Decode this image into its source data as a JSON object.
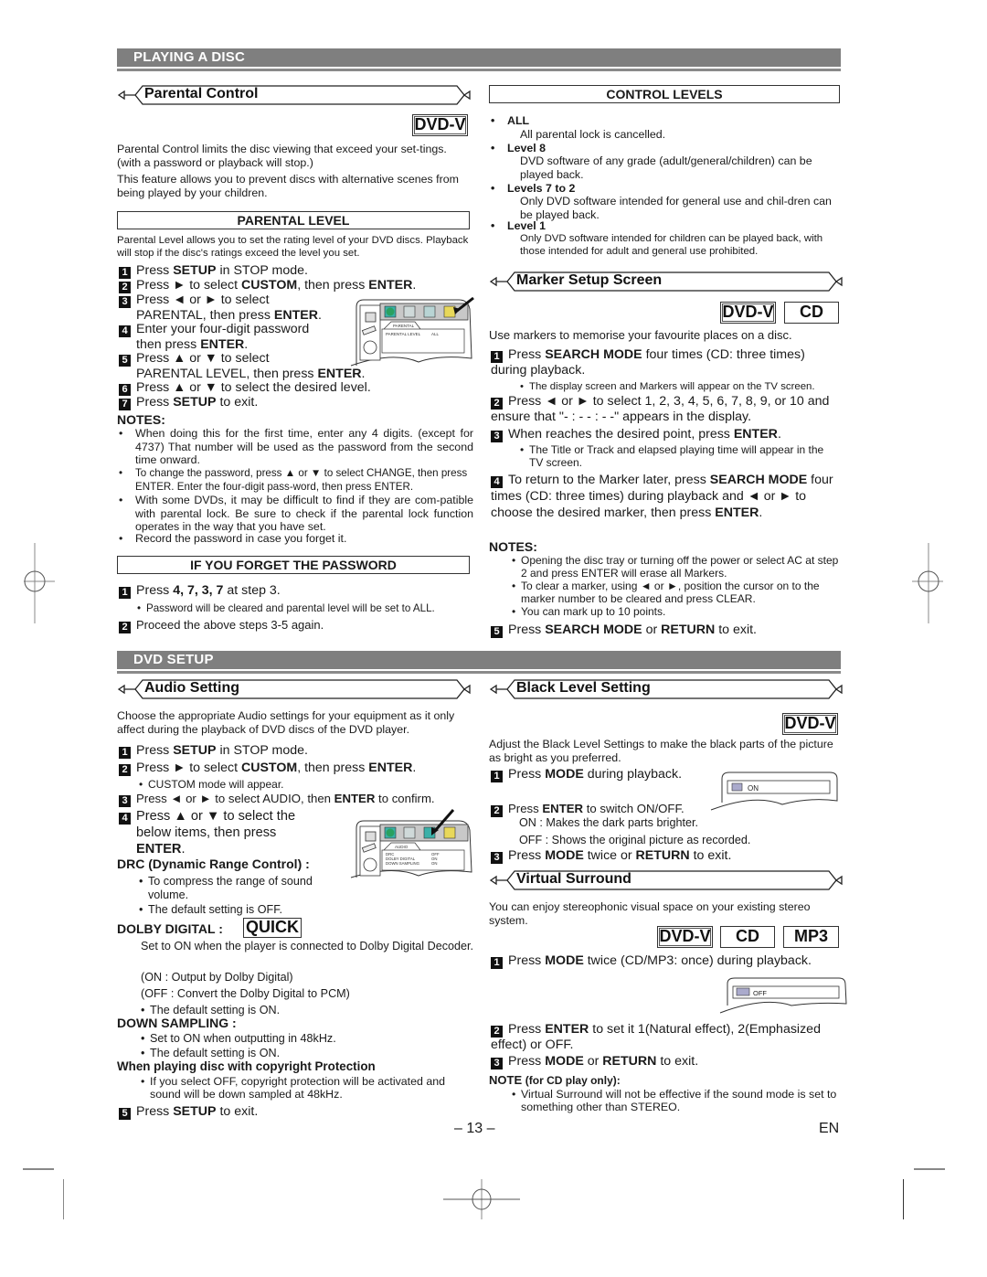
{
  "sections": {
    "playing_a_disc": "PLAYING A DISC",
    "dvd_setup": "DVD SETUP"
  },
  "badges": {
    "dvd_v": "DVD-V",
    "cd": "CD",
    "mp3": "MP3",
    "quick": "QUICK"
  },
  "parental_control": {
    "title": "Parental Control",
    "intro1": "Parental Control limits the disc viewing that exceed your set-tings. (with a password or playback will stop.)",
    "intro2": "This feature allows you to prevent discs with alternative scenes from being played by your children.",
    "parental_level_heading": "PARENTAL LEVEL",
    "parental_level_text": "Parental Level allows you to set the rating level of your DVD discs. Playback will stop if the disc's ratings exceed the level you set.",
    "steps": [
      {
        "n": "1",
        "pre": "Press ",
        "bold": "SETUP",
        "post": " in STOP mode."
      },
      {
        "n": "2",
        "pre": "Press ► to select ",
        "bold": "CUSTOM",
        "mid": ", then press ",
        "bold2": "ENTER",
        "post": "."
      },
      {
        "n": "3",
        "pre": "Press ◄ or ► to select",
        "line2": "PARENTAL, then press ",
        "bold": "ENTER",
        "post": "."
      },
      {
        "n": "4",
        "pre": "Enter your four-digit password",
        "line2": "then press ",
        "bold": "ENTER",
        "post": "."
      },
      {
        "n": "5",
        "pre": "Press ▲ or ▼ to select",
        "line2": "PARENTAL LEVEL, then press ",
        "bold": "ENTER",
        "post": "."
      },
      {
        "n": "6",
        "pre": "Press ▲ or ▼ to select the desired level."
      },
      {
        "n": "7",
        "pre": "Press ",
        "bold": "SETUP",
        "post": " to exit."
      }
    ],
    "osd": {
      "tab": "PARENTAL",
      "row_label": "PARENTAL LEVEL",
      "row_value": "ALL"
    },
    "notes_heading": "NOTES:",
    "notes": [
      "When doing this for the first time, enter any 4 digits. (except for 4737) That number will be used as the password from the second time onward.",
      "To change the password, press ▲ or ▼ to select CHANGE, then press ENTER. Enter the four-digit pass-word, then press ENTER.",
      "With some DVDs, it may be difficult to find if they are com-patible with parental lock. Be sure to check if the parental lock function operates in the way that you have set.",
      "Record the password in case you forget it."
    ],
    "forget_heading": "IF YOU FORGET THE PASSWORD",
    "forget_step1_pre": "Press ",
    "forget_step1_bold": "4, 7, 3, 7",
    "forget_step1_post": " at step 3.",
    "forget_step1_sub": "Password will be cleared and parental level will be set to ALL.",
    "forget_step2": "Proceed the above steps 3-5 again."
  },
  "control_levels": {
    "heading": "CONTROL LEVELS",
    "items": [
      {
        "label": "ALL",
        "desc": "All parental lock is cancelled."
      },
      {
        "label": "Level 8",
        "desc": "DVD software of any grade (adult/general/children) can be played back."
      },
      {
        "label": "Levels 7 to 2",
        "desc": "Only DVD software intended for general use and chil-dren can be played back."
      },
      {
        "label": "Level 1",
        "desc": "Only DVD software intended for children can be played back, with those intended for adult and general use prohibited."
      }
    ]
  },
  "marker_setup": {
    "title": "Marker Setup Screen",
    "intro": "Use markers to memorise your favourite places on a disc.",
    "step1_pre": "Press ",
    "step1_bold": "SEARCH MODE",
    "step1_post": " four times (CD: three times) during playback.",
    "step1_sub": "The display screen and Markers will appear on the TV screen.",
    "step2": "Press ◄ or ► to select 1, 2, 3, 4, 5, 6, 7, 8, 9, or 10 and ensure that \"- : - - : - -\" appears in the display.",
    "step3_pre": "When reaches the desired point, press ",
    "step3_bold": "ENTER",
    "step3_post": ".",
    "step3_sub": "The Title or Track and elapsed playing time will appear in the TV screen.",
    "step4_pre": "To return to the Marker later, press ",
    "step4_bold": "SEARCH MODE",
    "step4_post": " four times (CD: three times) during playback and ◄ or ► to choose the desired marker, then press ",
    "step4_bold2": "ENTER",
    "step4_end": ".",
    "notes_heading": "NOTES:",
    "notes": [
      "Opening the disc tray or turning off the power or select AC at step 2 and press ENTER will erase all Markers.",
      "To clear a marker, using ◄ or ►, position the cursor on to the marker number to be cleared and press CLEAR.",
      "You can mark up to 10 points."
    ],
    "step5_pre": "Press ",
    "step5_bold": "SEARCH MODE",
    "step5_mid": " or ",
    "step5_bold2": "RETURN",
    "step5_post": " to exit."
  },
  "audio_setting": {
    "title": "Audio Setting",
    "intro": "Choose the appropriate Audio settings for your equipment as it only affect during the playback of DVD discs of the DVD player.",
    "step1_pre": "Press ",
    "step1_bold": "SETUP",
    "step1_post": " in STOP mode.",
    "step2_pre": "Press ► to select ",
    "step2_bold": "CUSTOM",
    "step2_mid": ", then press ",
    "step2_bold2": "ENTER",
    "step2_post": ".",
    "step2_sub": "CUSTOM mode will appear.",
    "step3_pre": "Press ◄ or ► to select AUDIO, then ",
    "step3_bold": "ENTER",
    "step3_post": " to confirm.",
    "step4_l1": "Press ▲ or ▼ to select the",
    "step4_l2": "below items, then press",
    "step4_l3": "ENTER",
    "osd": {
      "tab": "AUDIO",
      "rows": [
        {
          "label": "DRC",
          "value": "OFF"
        },
        {
          "label": "DOLBY DIGITAL",
          "value": "ON"
        },
        {
          "label": "DOWN SAMPLING",
          "value": "ON"
        }
      ]
    },
    "drc_heading": "DRC (Dynamic Range Control) :",
    "drc_bullets": [
      "To compress the range of sound volume.",
      "The default setting is OFF."
    ],
    "dolby_heading": "DOLBY DIGITAL :",
    "dolby_text": "Set to ON when the player is connected to Dolby Digital Decoder.",
    "dolby_on": "(ON : Output by Dolby Digital)",
    "dolby_off": "(OFF : Convert the Dolby Digital to PCM)",
    "dolby_default": "The default setting is ON.",
    "down_heading": "DOWN SAMPLING :",
    "down_bullets": [
      "Set to ON when outputting in 48kHz.",
      "The default setting is ON."
    ],
    "copy_heading": "When playing disc with copyright Protection",
    "copy_bullet": "If you select OFF, copyright protection will be activated and sound will be down sampled at 48kHz.",
    "step5_pre": "Press ",
    "step5_bold": "SETUP",
    "step5_post": " to exit."
  },
  "black_level": {
    "title": "Black Level Setting",
    "intro": "Adjust the Black Level Settings to make the black parts of the picture as bright as you preferred.",
    "step1_pre": "Press ",
    "step1_bold": "MODE",
    "step1_post": " during playback.",
    "osd_value": "ON",
    "step2_pre": "Press ",
    "step2_bold": "ENTER",
    "step2_post": " to switch ON/OFF.",
    "on_desc": "ON : Makes the dark parts brighter.",
    "off_desc": "OFF : Shows the original picture as recorded.",
    "step3_pre": "Press ",
    "step3_bold": "MODE",
    "step3_mid": " twice or ",
    "step3_bold2": "RETURN",
    "step3_post": " to exit."
  },
  "virtual_surround": {
    "title": "Virtual Surround",
    "intro": "You can enjoy stereophonic visual space on your existing stereo system.",
    "step1_pre": "Press ",
    "step1_bold": "MODE",
    "step1_post": " twice (CD/MP3: once) during playback.",
    "osd_value": "OFF",
    "step2_pre": "Press ",
    "step2_bold": "ENTER",
    "step2_post": " to set it 1(Natural effect), 2(Emphasized effect) or OFF.",
    "step3_pre": "Press ",
    "step3_bold": "MODE",
    "step3_mid": " or ",
    "step3_bold2": "RETURN",
    "step3_post": " to exit.",
    "note_heading": "NOTE",
    "note_qualifier": "(for CD play only):",
    "note": "Virtual Surround will not be effective if the sound mode is set to something other than STEREO."
  },
  "footer": {
    "page_number": "– 13 –",
    "language": "EN"
  }
}
